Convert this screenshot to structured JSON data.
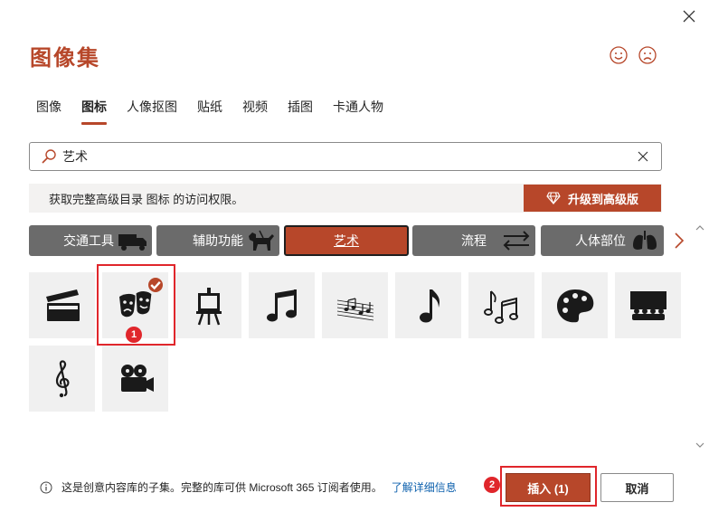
{
  "dialog": {
    "title": "图像集",
    "close_icon": "close-icon",
    "feedback": {
      "smile_icon": "smile-icon",
      "frown_icon": "frown-icon"
    }
  },
  "tabs": [
    {
      "label": "图像",
      "active": false
    },
    {
      "label": "图标",
      "active": true
    },
    {
      "label": "人像抠图",
      "active": false
    },
    {
      "label": "贴纸",
      "active": false
    },
    {
      "label": "视频",
      "active": false
    },
    {
      "label": "插图",
      "active": false
    },
    {
      "label": "卡通人物",
      "active": false
    }
  ],
  "search": {
    "value": "艺术",
    "icon": "search-icon",
    "clear_icon": "clear-icon"
  },
  "banner": {
    "message": "获取完整高级目录 图标 的访问权限。",
    "upgrade_label": "升级到高级版",
    "upgrade_icon": "diamond-icon"
  },
  "categories": [
    {
      "label": "交通工具",
      "icon": "truck-icon",
      "active": false
    },
    {
      "label": "辅助功能",
      "icon": "guide-dog-icon",
      "active": false
    },
    {
      "label": "艺术",
      "icon": "",
      "active": true
    },
    {
      "label": "流程",
      "icon": "exchange-arrows-icon",
      "active": false
    },
    {
      "label": "人体部位",
      "icon": "lungs-icon",
      "active": false
    }
  ],
  "categories_next_icon": "chevron-right-icon",
  "icons": [
    {
      "name": "clapperboard-icon",
      "selected": false
    },
    {
      "name": "theater-masks-icon",
      "selected": true
    },
    {
      "name": "easel-icon",
      "selected": false
    },
    {
      "name": "music-notes-icon",
      "selected": false
    },
    {
      "name": "music-staff-icon",
      "selected": false
    },
    {
      "name": "eighth-note-icon",
      "selected": false
    },
    {
      "name": "beamed-notes-icon",
      "selected": false
    },
    {
      "name": "paint-palette-icon",
      "selected": false
    },
    {
      "name": "cinema-audience-icon",
      "selected": false
    },
    {
      "name": "treble-clef-icon",
      "selected": false
    },
    {
      "name": "movie-camera-icon",
      "selected": false
    }
  ],
  "annotations": {
    "badge_1": "1",
    "badge_2": "2"
  },
  "footer": {
    "info_icon": "info-icon",
    "text": "这是创意内容库的子集。完整的库可供 Microsoft 365 订阅者使用。",
    "link": "了解详细信息",
    "insert_label": "插入 (1)",
    "cancel_label": "取消"
  },
  "colors": {
    "accent": "#b7472a",
    "category_bg": "#6b6b6b",
    "highlight": "#e0262b",
    "link": "#0f62ae"
  }
}
